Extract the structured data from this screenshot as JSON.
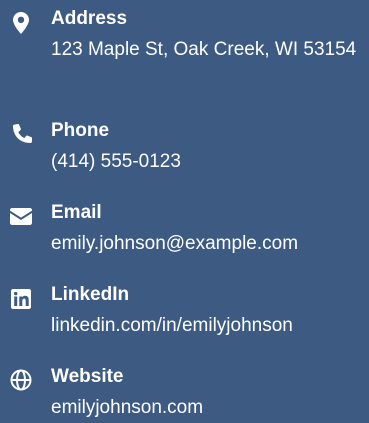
{
  "theme": {
    "background": "#3c5a82",
    "text": "#ffffff"
  },
  "contacts": [
    {
      "icon": "map-pin-icon",
      "label": "Address",
      "value": "123 Maple St, Oak Creek, WI 53154"
    },
    {
      "icon": "phone-icon",
      "label": "Phone",
      "value": "(414) 555-0123"
    },
    {
      "icon": "envelope-icon",
      "label": "Email",
      "value": "emily.johnson@example.com"
    },
    {
      "icon": "linkedin-icon",
      "label": "LinkedIn",
      "value": "linkedin.com/in/emilyjohnson"
    },
    {
      "icon": "globe-icon",
      "label": "Website",
      "value": "emilyjohnson.com"
    }
  ]
}
